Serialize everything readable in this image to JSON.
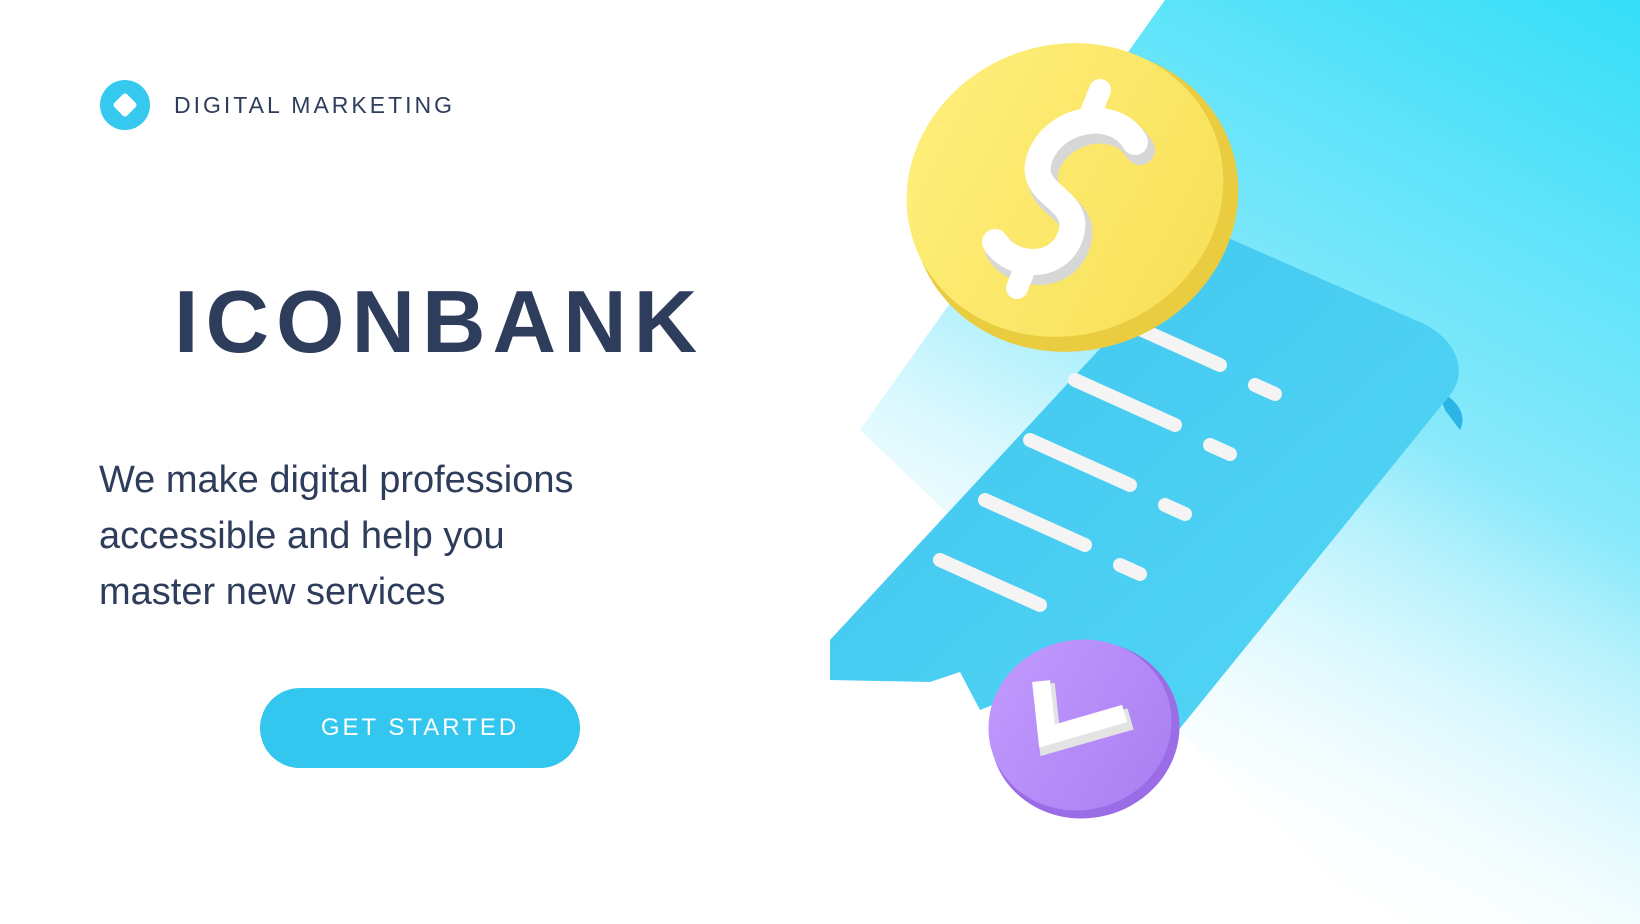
{
  "brand": {
    "name": "DIGITAL MARKETING",
    "logo_icon": "diamond-in-circle-icon"
  },
  "hero": {
    "title": "ICONBANK",
    "tagline_lines": [
      "We make digital professions",
      "accessible and help you",
      "master new services"
    ],
    "cta_label": "GET STARTED"
  },
  "illustration": {
    "icons": [
      "dollar-coin-icon",
      "receipt-icon",
      "checkmark-badge-icon"
    ]
  },
  "colors": {
    "text": "#2f3d5c",
    "accent": "#33c6ef",
    "coin": "#fde96a",
    "receipt": "#3dcaf1",
    "check_badge": "#b98af5",
    "background": "#ffffff"
  }
}
